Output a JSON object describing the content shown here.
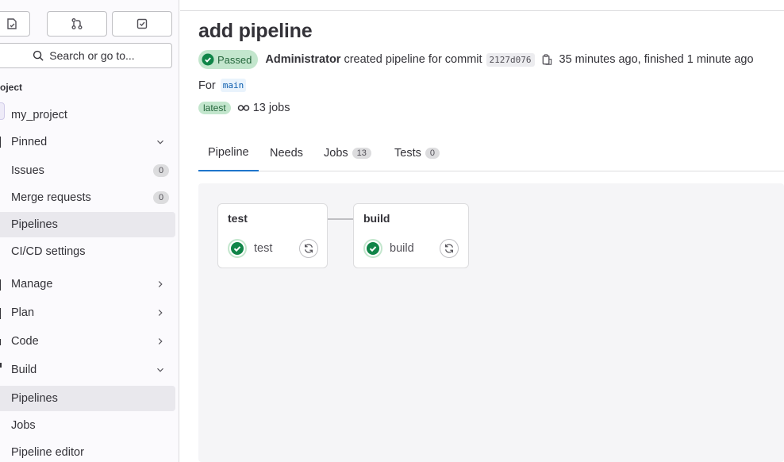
{
  "sidebar": {
    "search_label": "Search or go to...",
    "section_label": "oject",
    "project_name": "my_project",
    "pinned": {
      "label": "Pinned",
      "items": [
        {
          "label": "Issues",
          "count": "0"
        },
        {
          "label": "Merge requests",
          "count": "0"
        },
        {
          "label": "Pipelines"
        },
        {
          "label": "CI/CD settings"
        }
      ]
    },
    "groups": [
      {
        "label": "Manage"
      },
      {
        "label": "Plan"
      },
      {
        "label": "Code"
      },
      {
        "label": "Build"
      }
    ],
    "build_items": [
      {
        "label": "Pipelines"
      },
      {
        "label": "Jobs"
      },
      {
        "label": "Pipeline editor"
      }
    ]
  },
  "pipeline": {
    "title": "add pipeline",
    "status": "Passed",
    "author": "Administrator",
    "action_text": "created pipeline for commit",
    "commit_sha": "2127d076",
    "timing": "35 minutes ago, finished 1 minute ago",
    "for_label": "For",
    "branch": "main",
    "latest_badge": "latest",
    "jobs_summary": "13 jobs"
  },
  "tabs": [
    {
      "label": "Pipeline"
    },
    {
      "label": "Needs"
    },
    {
      "label": "Jobs",
      "count": "13"
    },
    {
      "label": "Tests",
      "count": "0"
    }
  ],
  "graph": {
    "stages": [
      {
        "title": "test",
        "job": "test"
      },
      {
        "title": "build",
        "job": "build"
      }
    ]
  },
  "colors": {
    "success": "#108548",
    "active_tab": "#1f75cb",
    "active_nav_bg": "#e9e8ed"
  }
}
